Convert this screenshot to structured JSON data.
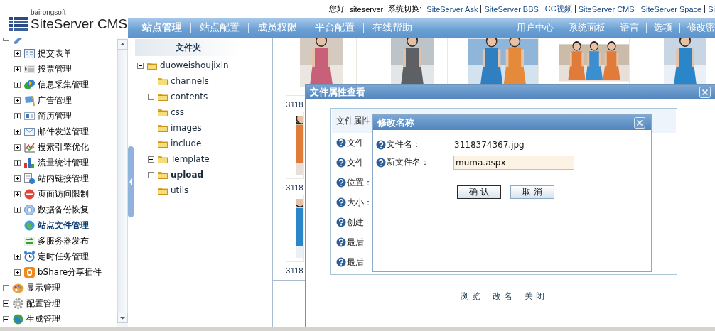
{
  "header": {
    "logo_subtitle": "bairongsoft",
    "logo": "SiteServer CMS",
    "greeting": "您好",
    "user": "siteserver",
    "switch_label": "系统切换:",
    "systems": [
      "SiteServer Ask",
      "SiteServer BBS",
      "CC视频",
      "SiteServer CMS",
      "SiteServer Space",
      "Si"
    ]
  },
  "nav": {
    "items": [
      {
        "label": "站点管理",
        "selected": true
      },
      {
        "label": "站点配置",
        "selected": false
      },
      {
        "label": "成员权限",
        "selected": false
      },
      {
        "label": "平台配置",
        "selected": false
      },
      {
        "label": "在线帮助",
        "selected": false
      }
    ],
    "right_items": [
      "用户中心",
      "系统面板",
      "语言",
      "选项",
      "修改密"
    ]
  },
  "sidebar": {
    "items": [
      {
        "expandable": true,
        "expanded": true,
        "children": [
          {
            "label": "提交表单",
            "expandable": true,
            "expanded": false,
            "selected": false
          },
          {
            "label": "投票管理",
            "expandable": true,
            "expanded": false,
            "selected": false
          },
          {
            "label": "信息采集管理",
            "expandable": true,
            "expanded": false,
            "selected": false
          },
          {
            "label": "广告管理",
            "expandable": true,
            "expanded": false,
            "selected": false
          },
          {
            "label": "简历管理",
            "expandable": true,
            "expanded": false,
            "selected": false
          },
          {
            "label": "邮件发送管理",
            "expandable": true,
            "expanded": false,
            "selected": false
          },
          {
            "label": "搜索引擎优化",
            "expandable": true,
            "expanded": false,
            "selected": false
          },
          {
            "label": "流量统计管理",
            "expandable": true,
            "expanded": false,
            "selected": false
          },
          {
            "label": "站内链接管理",
            "expandable": true,
            "expanded": false,
            "selected": false
          },
          {
            "label": "页面访问限制",
            "expandable": true,
            "expanded": false,
            "selected": false
          },
          {
            "label": "数据备份恢复",
            "expandable": true,
            "expanded": false,
            "selected": false
          },
          {
            "label": "站点文件管理",
            "expandable": false,
            "selected": true
          },
          {
            "label": "多服务器发布",
            "expandable": false,
            "selected": false
          },
          {
            "label": "定时任务管理",
            "expandable": true,
            "expanded": false,
            "selected": false
          },
          {
            "label": "bShare分享插件",
            "expandable": true,
            "expanded": false,
            "selected": false
          }
        ]
      },
      {
        "label": "显示管理",
        "expandable": true,
        "expanded": false,
        "selected": false
      },
      {
        "label": "配置管理",
        "expandable": true,
        "expanded": false,
        "selected": false
      },
      {
        "label": "生成管理",
        "expandable": true,
        "expanded": false,
        "selected": false
      }
    ]
  },
  "folders": {
    "title": "文件夹",
    "items": [
      {
        "label": "duoweishoujixin",
        "expandable": true,
        "expanded": true,
        "selected": false,
        "children": [
          {
            "label": "channels",
            "expandable": false,
            "selected": false
          },
          {
            "label": "contents",
            "expandable": true,
            "expanded": false,
            "selected": false
          },
          {
            "label": "css",
            "expandable": false,
            "selected": false
          },
          {
            "label": "images",
            "expandable": false,
            "selected": false
          },
          {
            "label": "include",
            "expandable": false,
            "selected": false
          },
          {
            "label": "Template",
            "expandable": true,
            "expanded": false,
            "selected": false
          },
          {
            "label": "upload",
            "expandable": true,
            "expanded": false,
            "selected": true
          },
          {
            "label": "utils",
            "expandable": false,
            "selected": false
          }
        ]
      }
    ]
  },
  "gallery": {
    "rows": [
      {
        "items": [
          {
            "kind": "picture",
            "label": "3118"
          },
          {
            "kind": "picture"
          },
          {
            "kind": "picture"
          },
          {
            "kind": "picture"
          },
          {
            "kind": "picture"
          }
        ]
      },
      {
        "items": [
          {
            "kind": "picture",
            "label": "3118"
          }
        ]
      },
      {
        "items": [
          {
            "kind": "picture",
            "label": "3118"
          }
        ]
      }
    ]
  },
  "property_dialog": {
    "title": "文件属性查看",
    "section_title": "文件属性",
    "fields": [
      "文件",
      "文件",
      "位置：",
      "大小：",
      "创建",
      "最后",
      "最后"
    ],
    "actions": [
      "浏览",
      "改名",
      "关闭"
    ]
  },
  "rename_dialog": {
    "title": "修改名称",
    "fields": [
      {
        "kind": "text",
        "label": "文件名：",
        "value": "3118374367.jpg"
      },
      {
        "kind": "input",
        "label": "新文件名：",
        "value": "muma.aspx"
      }
    ],
    "buttons": [
      {
        "label": "确 认",
        "default": true
      },
      {
        "label": "取 消",
        "default": false
      }
    ]
  }
}
